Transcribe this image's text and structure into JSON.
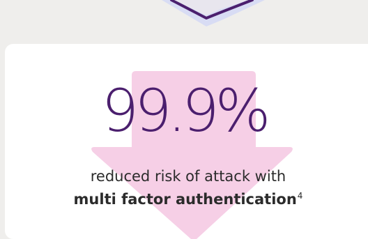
{
  "stat": {
    "value": "99.9%"
  },
  "description": {
    "line1": "reduced risk of attack with",
    "line2": "multi factor authentication",
    "footnote": "4"
  },
  "colors": {
    "background": "#efeeec",
    "card": "#ffffff",
    "stat_text": "#4b1f6e",
    "arrow_fill": "#f6cfe6",
    "shield_border": "#d8dcf4",
    "shield_outline": "#4b1f6e"
  },
  "icons": {
    "top": "shield-icon",
    "background_graphic": "down-arrow-icon"
  }
}
